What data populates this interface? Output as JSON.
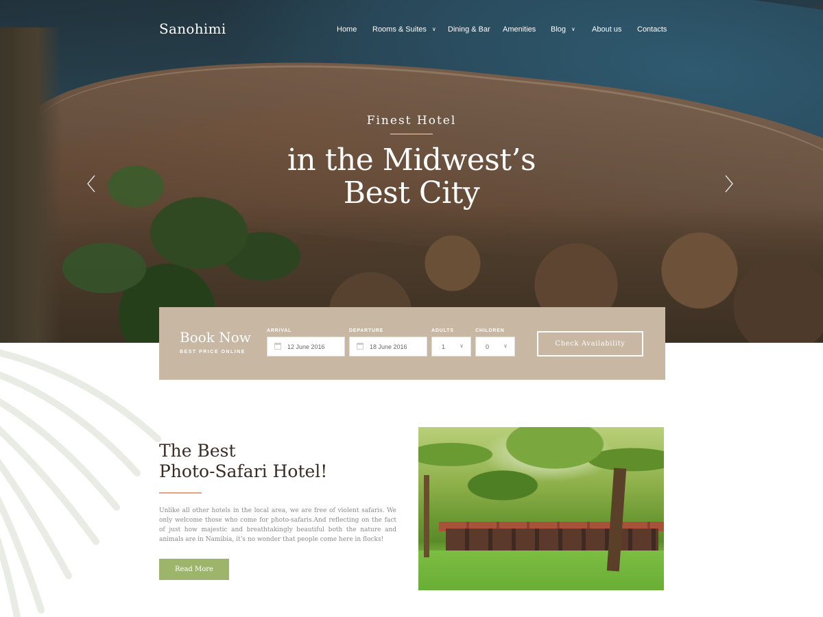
{
  "header": {
    "logo": "Sanohimi",
    "nav": [
      {
        "label": "Home",
        "has_dropdown": false
      },
      {
        "label": "Rooms & Suites",
        "has_dropdown": true
      },
      {
        "label": "Dining & Bar",
        "has_dropdown": false
      },
      {
        "label": "Amenities",
        "has_dropdown": false
      },
      {
        "label": "Blog",
        "has_dropdown": true
      },
      {
        "label": "About us",
        "has_dropdown": false
      },
      {
        "label": "Contacts",
        "has_dropdown": false
      }
    ]
  },
  "hero": {
    "subtitle": "Finest Hotel",
    "title_line1": "in the Midwest’s",
    "title_line2": "Best City"
  },
  "booking": {
    "title": "Book Now",
    "subtitle": "BEST PRICE ONLINE",
    "arrival_label": "ARRIVAL",
    "arrival_value": "12 June 2016",
    "departure_label": "DEPARTURE",
    "departure_value": "18 June 2016",
    "adults_label": "ADULTS",
    "adults_value": "1",
    "children_label": "CHILDREN",
    "children_value": "0",
    "button_label": "Check Availability"
  },
  "about": {
    "title_line1": "The Best",
    "title_line2": "Photo-Safari Hotel!",
    "text": "Unlike all other hotels in the local area, we are free of violent safaris. We only welcome those who come for photo-safaris.And reflecting on the fact of just how majestic and breathtakingly beautiful both the nature and animals are in Namibia, it’s no wonder that people come here in flocks!",
    "button_label": "Read More"
  },
  "colors": {
    "booking_bg": "#c7b7a3",
    "accent_green": "#9db56a",
    "accent_rule": "#e5a183",
    "heading": "#3a2c25"
  },
  "icons": {
    "calendar": "calendar-icon",
    "dropdown": "chevron-down-icon",
    "prev": "chevron-left-icon",
    "next": "chevron-right-icon"
  }
}
